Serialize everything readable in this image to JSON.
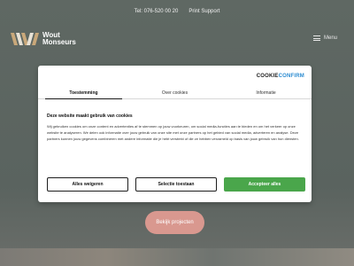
{
  "topbar": {
    "phone": "Tel: 076-520 00 20",
    "support": "Print Support"
  },
  "logo": {
    "line1": "Wout",
    "line2": "Monseurs"
  },
  "menu": {
    "label": "Menu",
    "icon": "hamburger-icon"
  },
  "cta": {
    "label": "Bekijk projecten"
  },
  "cookie_dialog": {
    "brand_part1": "COOKIE",
    "brand_part2": "CONFIRM",
    "tabs": [
      "Toestemming",
      "Over cookies",
      "Informatie"
    ],
    "active_tab": "Toestemming",
    "title": "Deze website maakt gebruik van cookies",
    "text": "Wij gebruiken cookies om onze content en advertenties af te stemmen op jouw voorkeuren, om social media-functies aan te bieden en om het verkeer op onze website te analyseren. We delen ook informatie over jouw gebruik van onze site met onze partners op het gebied van social media, adverteren en analyse. Deze partners kunnen jouw gegevens combineren met andere informatie die je hebt verstrekt of die ze hebben verzameld op basis van jouw gebruik van hun diensten.",
    "buttons": {
      "reject": "Alles weigeren",
      "select": "Selectie toestaan",
      "accept": "Accepteer alles"
    }
  },
  "colors": {
    "accept": "#4aa64b",
    "cta": "#d9988f",
    "background": "#5d6661",
    "brand_accent": "#2a8bd1"
  }
}
